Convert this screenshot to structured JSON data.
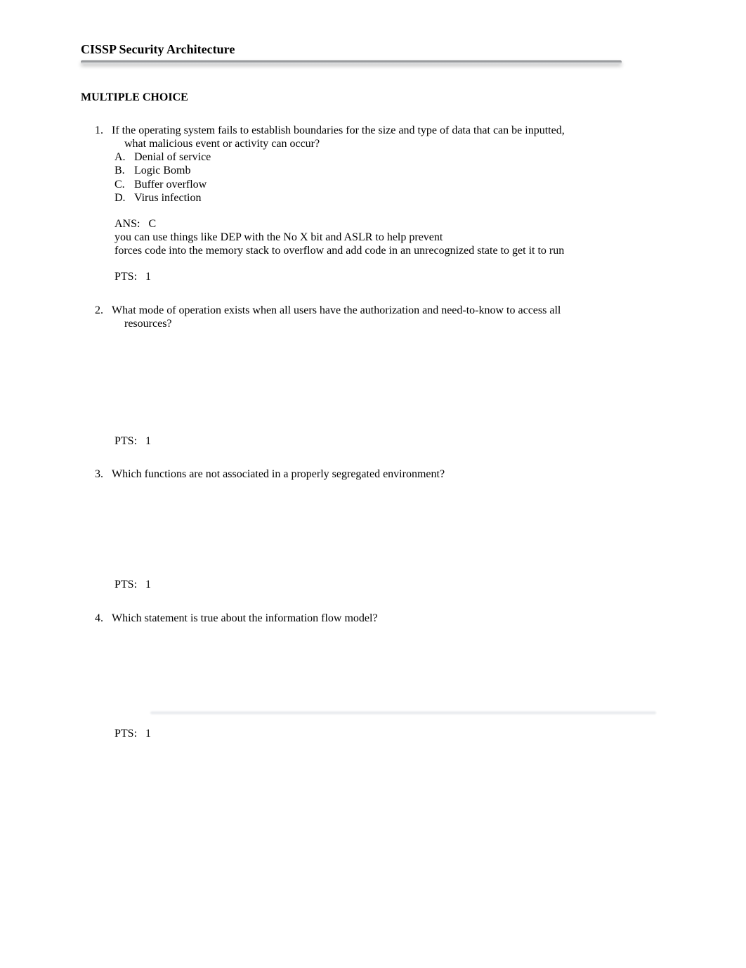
{
  "document": {
    "title": "CISSP Security Architecture",
    "section_heading": "MULTIPLE CHOICE"
  },
  "questions": [
    {
      "number": "1.",
      "stem_line1": "If the operating system fails to establish boundaries for the size and type of data that can be inputted,",
      "stem_line2": "what malicious event or activity can occur?",
      "options": [
        {
          "letter": "A.",
          "text": "Denial of service"
        },
        {
          "letter": "B.",
          "text": "Logic Bomb"
        },
        {
          "letter": "C.",
          "text": "Buffer overflow"
        },
        {
          "letter": "D.",
          "text": "Virus infection"
        }
      ],
      "answer_label": "ANS:",
      "answer_value": "C",
      "explain_line1": "you can use things like DEP with the No X bit and ASLR to help prevent",
      "explain_line2": "forces code into the memory stack to overflow and add code in an unrecognized state to get it to run",
      "pts_label": "PTS:",
      "pts_value": "1"
    },
    {
      "number": "2.",
      "stem_line1": "What mode of operation exists when all users have the authorization and need-to-know to access all",
      "stem_line2": "resources?",
      "pts_label": "PTS:",
      "pts_value": "1"
    },
    {
      "number": "3.",
      "stem_line1": "Which functions are not associated in a properly segregated environment?",
      "pts_label": "PTS:",
      "pts_value": "1"
    },
    {
      "number": "4.",
      "stem_line1": "Which statement is true about the information flow model?",
      "pts_label": "PTS:",
      "pts_value": "1"
    }
  ]
}
